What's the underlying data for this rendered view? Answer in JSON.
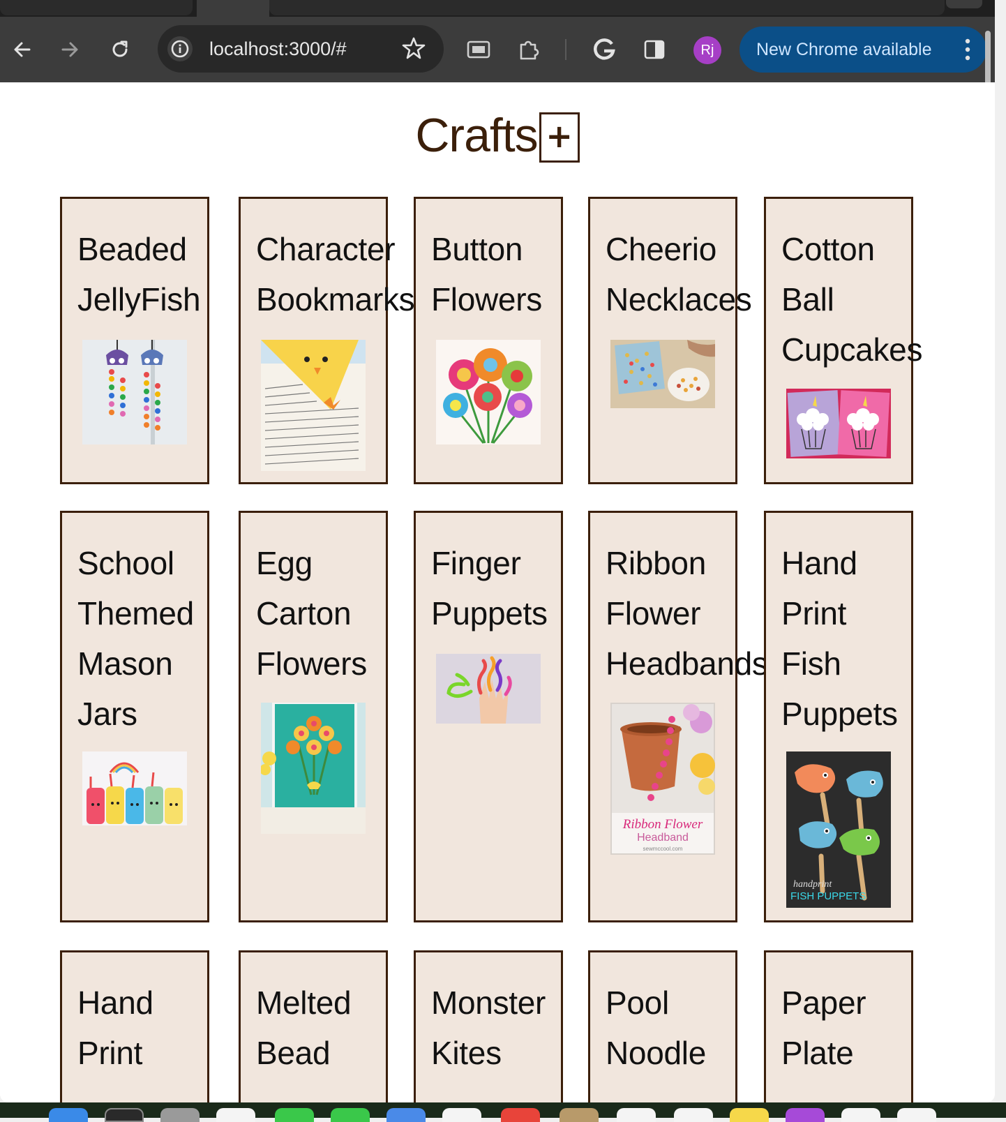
{
  "browser": {
    "address_url": "localhost:3000/#",
    "update_label": "New Chrome available",
    "profile_initials": "Rj",
    "icons": [
      "back-icon",
      "forward-icon",
      "reload-icon",
      "site-info-icon",
      "bookmark-star-icon",
      "cast-icon",
      "extensions-icon",
      "google-lens-icon",
      "side-panel-icon",
      "menu-dots-icon"
    ]
  },
  "page": {
    "title": "Crafts",
    "add_label": "+"
  },
  "crafts": [
    {
      "title": "Beaded\nJellyFish"
    },
    {
      "title": "Character\nBookmarks"
    },
    {
      "title": "Button\nFlowers"
    },
    {
      "title": "Cheerio\nNecklaces"
    },
    {
      "title": "Cotton\nBall\nCupcakes"
    },
    {
      "title": "School\nThemed\nMason\nJars"
    },
    {
      "title": "Egg\nCarton\nFlowers"
    },
    {
      "title": "Finger\nPuppets"
    },
    {
      "title": "Ribbon\nFlower\nHeadbands"
    },
    {
      "title": "Hand\nPrint\nFish\nPuppets"
    },
    {
      "title": "Hand\nPrint"
    },
    {
      "title": "Melted\nBead"
    },
    {
      "title": "Monster\nKites"
    },
    {
      "title": "Pool\nNoodle"
    },
    {
      "title": "Paper\nPlate"
    }
  ],
  "thumb_captions": {
    "ribbon_line1": "Ribbon Flower",
    "ribbon_line2": "Headband",
    "ribbon_site": "sewmccool.com",
    "fish_line1": "handprint",
    "fish_line2": "FISH PUPPETS"
  },
  "colors": {
    "brand_brown": "#3b1f0a",
    "card_bg": "#f1e6dd",
    "update_pill": "#0b4f88"
  }
}
